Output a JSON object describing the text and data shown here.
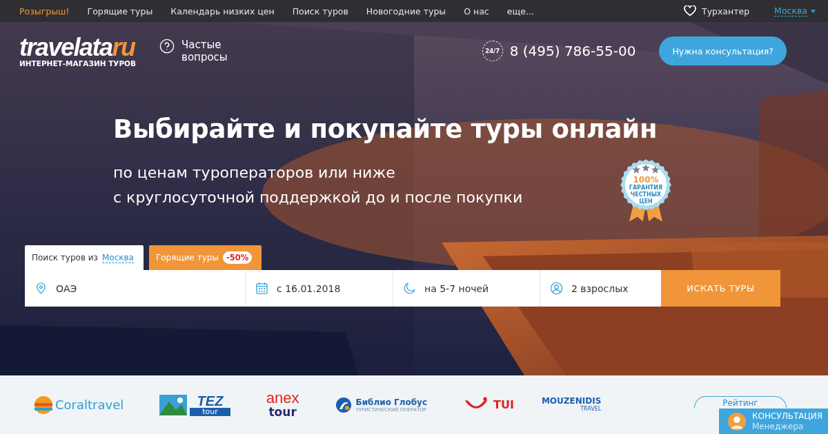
{
  "top_nav": {
    "items": [
      {
        "label": "Розыгрыш!",
        "kind": "promo"
      },
      {
        "label": "Горящие туры",
        "kind": "link"
      },
      {
        "label": "Календарь низких цен",
        "kind": "link"
      },
      {
        "label": "Поиск туров",
        "kind": "link"
      },
      {
        "label": "Новогодние туры",
        "kind": "link"
      },
      {
        "label": "О нас",
        "kind": "link"
      },
      {
        "label": "еще...",
        "kind": "link"
      }
    ],
    "favorites": "Турхантер",
    "city": "Москва"
  },
  "header": {
    "logo": {
      "name": "travelata",
      "suffix": "ru",
      "tagline": "ИНТЕРНЕТ-МАГАЗИН ТУРОВ"
    },
    "faq": "Частые вопросы",
    "phone_badge": "24/7",
    "phone": "8 (495) 786-55-00",
    "consult_button": "Нужна консультация?"
  },
  "hero": {
    "title": "Выбирайте и покупайте туры онлайн",
    "subtitle_lines": [
      "по ценам туроператоров или ниже",
      "с круглосуточной поддержкой до и после покупки"
    ],
    "badge": {
      "lines": [
        "100%",
        "ГАРАНТИЯ",
        "ЧЕСТНЫХ",
        "ЦЕН"
      ],
      "stars": 3
    }
  },
  "search": {
    "tabs": [
      {
        "label": "Поиск туров из",
        "link": "Москва",
        "selected": true
      },
      {
        "label": "Горящие туры",
        "discount": "-50%",
        "selected": false
      }
    ],
    "fields": [
      {
        "kind": "place",
        "value": "ОАЭ"
      },
      {
        "kind": "date",
        "value": "с 16.01.2018"
      },
      {
        "kind": "nights",
        "value": "на 5-7 ночей"
      },
      {
        "kind": "people",
        "value": "2 взрослых"
      }
    ],
    "button": "ИСКАТЬ ТУРЫ"
  },
  "partners": {
    "logos": [
      {
        "kind": "coral",
        "text": "Coraltravel"
      },
      {
        "kind": "tez",
        "text": "TEZ",
        "sub": "tour"
      },
      {
        "kind": "anex",
        "text": "anex",
        "sub": "tour"
      },
      {
        "kind": "biblio",
        "text": "Библио Глобус",
        "sub": "ТУРИСТИЧЕСКИЙ ОПЕРАТОР"
      },
      {
        "kind": "tui",
        "text": "TUI"
      },
      {
        "kind": "mouzenidis",
        "text": "MOUZENIDIS",
        "sub": "TRAVEL"
      }
    ],
    "rating_button": "Рейтинг"
  },
  "consult_widget": {
    "title": "КОНСУЛЬТАЦИЯ",
    "subtitle": "Менеджера"
  }
}
